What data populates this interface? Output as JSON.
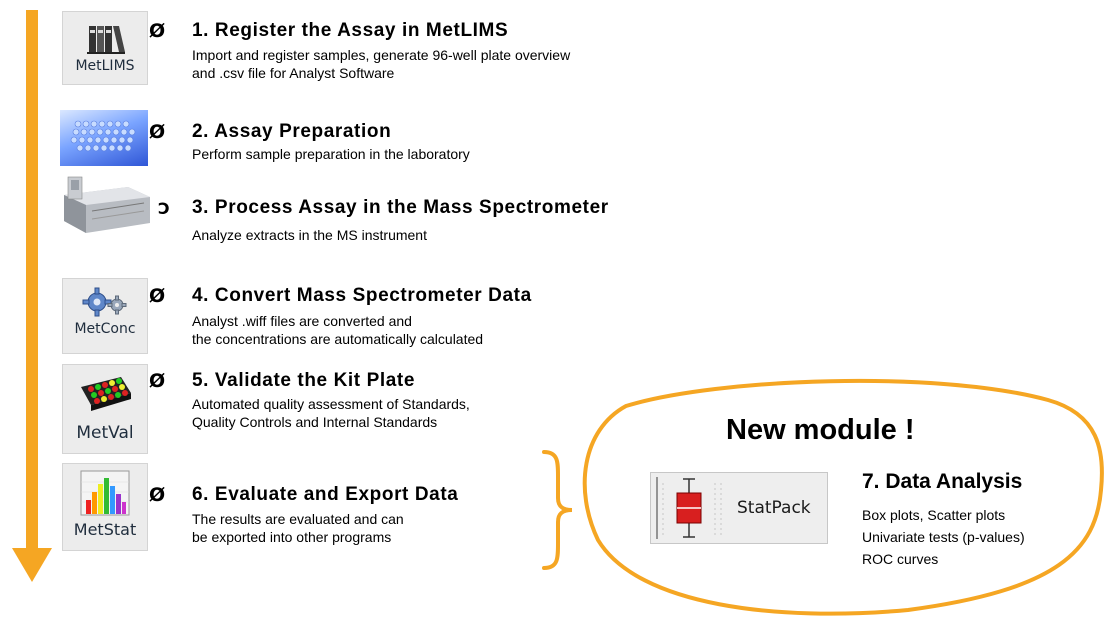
{
  "colors": {
    "accent_orange": "#f5a623",
    "title_text": "#000000",
    "icon_bg": "#ececec"
  },
  "steps": [
    {
      "icon": "metlims-binders-icon",
      "icon_label": "MetLIMS",
      "bullet": "Ø",
      "title": "1. Register the Assay in MetLIMS",
      "desc": [
        "Import and register samples, generate 96-well plate overview",
        "and .csv file for Analyst Software"
      ]
    },
    {
      "icon": "well-plate-icon",
      "icon_label": "",
      "bullet": "Ø",
      "title": "2. Assay Preparation",
      "desc": [
        "Perform sample preparation in the laboratory"
      ]
    },
    {
      "icon": "mass-spectrometer-icon",
      "icon_label": "",
      "bullet": "Ɔ",
      "title": "3. Process Assay in the Mass Spectrometer",
      "desc": [
        "Analyze extracts in the MS instrument"
      ]
    },
    {
      "icon": "gears-icon",
      "icon_label": "MetConc",
      "bullet": "Ø",
      "title": "4. Convert Mass Spectrometer Data",
      "desc": [
        "Analyst .wiff files are converted and",
        "the concentrations are automatically calculated"
      ]
    },
    {
      "icon": "kit-plate-icon",
      "icon_label": "MetVal",
      "bullet": "Ø",
      "title": "5. Validate the Kit Plate",
      "desc": [
        "Automated quality assessment of Standards,",
        "Quality Controls and Internal Standards"
      ]
    },
    {
      "icon": "bar-chart-icon",
      "icon_label": "MetStat",
      "bullet": "Ø",
      "title": "6. Evaluate and Export Data",
      "desc": [
        "The results are evaluated and can",
        "be exported into other programs"
      ]
    }
  ],
  "new_module": {
    "heading": "New module !",
    "button_label": "StatPack",
    "title": "7. Data Analysis",
    "lines": [
      "Box plots, Scatter plots",
      "Univariate tests (p-values)",
      "ROC curves"
    ]
  }
}
